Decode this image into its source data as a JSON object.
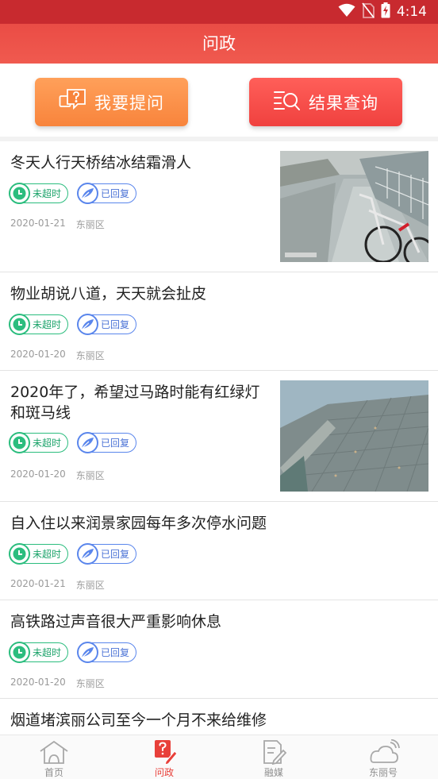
{
  "status_bar": {
    "time": "4:14",
    "icons": [
      "wifi-icon",
      "no-sim-icon",
      "battery-charging-icon"
    ]
  },
  "header": {
    "title": "问政"
  },
  "actions": {
    "ask": {
      "label": "我要提问",
      "icon": "question-chat-icon",
      "color": "#f8843c"
    },
    "query": {
      "label": "结果查询",
      "icon": "list-search-icon",
      "color": "#f0413f"
    }
  },
  "badges": {
    "not_overdue": "未超时",
    "replied": "已回复"
  },
  "colors": {
    "brand_red": "#e8403a",
    "status_green": "#2bbd7e",
    "reply_blue": "#5a86ec"
  },
  "questions": [
    {
      "title": "冬天人行天桥结冰结霜滑人",
      "date": "2020-01-21",
      "district": "东丽区",
      "has_image": true,
      "image": "icy-footbridge-stairs-with-bicycle"
    },
    {
      "title": "物业胡说八道，天天就会扯皮",
      "date": "2020-01-20",
      "district": "东丽区",
      "has_image": false
    },
    {
      "title": "2020年了，希望过马路时能有红绿灯和斑马线",
      "date": "2020-01-20",
      "district": "东丽区",
      "has_image": true,
      "image": "paved-sidewalk-curb"
    },
    {
      "title": "自入住以来润景家园每年多次停水问题",
      "date": "2020-01-21",
      "district": "东丽区",
      "has_image": false
    },
    {
      "title": "高铁路过声音很大严重影响休息",
      "date": "2020-01-20",
      "district": "东丽区",
      "has_image": false
    },
    {
      "title": "烟道堵滨丽公司至今一个月不来给维修",
      "has_image": false
    }
  ],
  "tabs": [
    {
      "label": "首页",
      "icon": "home-icon",
      "active": false
    },
    {
      "label": "问政",
      "icon": "question-pen-icon",
      "active": true
    },
    {
      "label": "融媒",
      "icon": "media-edit-icon",
      "active": false
    },
    {
      "label": "东丽号",
      "icon": "cloud-signal-icon",
      "active": false
    }
  ]
}
